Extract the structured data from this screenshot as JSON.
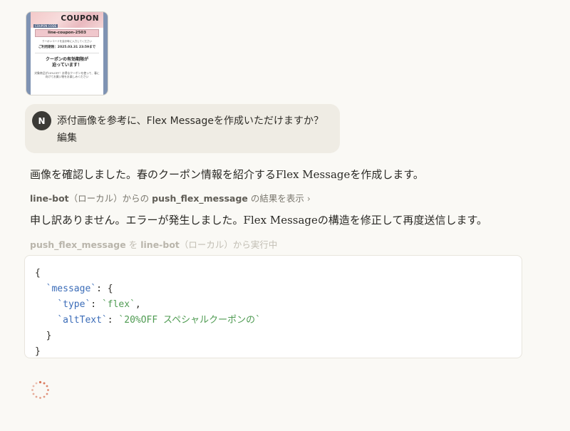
{
  "attachment": {
    "coupon_word": "COUPON",
    "code_tag": "COUPON CODE",
    "coupon_code": "line-coupon-2503",
    "tiny_notice": "クーポンコードを会計時に入力してください",
    "deadline": "ご利用期限：2025.03.31 23:59まで",
    "headline_1": "クーポンの有効期限が",
    "headline_2": "迫っています！",
    "body": "対象商品が20%OFF！お得なクーポンを使って、春に向けてお買い物をお楽しみください"
  },
  "user_message": {
    "avatar_initial": "N",
    "text": "添付画像を参考に、Flex Messageを作成いただけますか？",
    "edit_label": "編集"
  },
  "assistant": {
    "message_1": "画像を確認しました。春のクーポン情報を紹介するFlex Messageを作成します。",
    "tool_call_1": {
      "source": "line-bot",
      "scope": "（ローカル）からの",
      "tool": "push_flex_message",
      "suffix": "の結果を表示",
      "chevron": "›"
    },
    "message_2": "申し訳ありません。エラーが発生しました。Flex Messageの構造を修正して再度送信します。",
    "tool_call_2": {
      "tool": "push_flex_message",
      "mid": "を",
      "source": "line-bot",
      "suffix": "（ローカル）から実行中"
    }
  },
  "code": {
    "line1": "{",
    "line2_key": "`message`",
    "line2_rest": ": {",
    "line3_key": "`type`",
    "line3_sep": ": ",
    "line3_val": "`flex`",
    "line3_end": ",",
    "line4_key": "`altText`",
    "line4_sep": ": ",
    "line4_val": "`20%OFF スペシャルクーポンの`",
    "line5": "}",
    "line6": "}"
  },
  "colors": {
    "background": "#faf9f5",
    "bubble": "#efece4",
    "spinner": "#d9775a",
    "code_key": "#3b6cb8",
    "code_string": "#4f9b52"
  }
}
